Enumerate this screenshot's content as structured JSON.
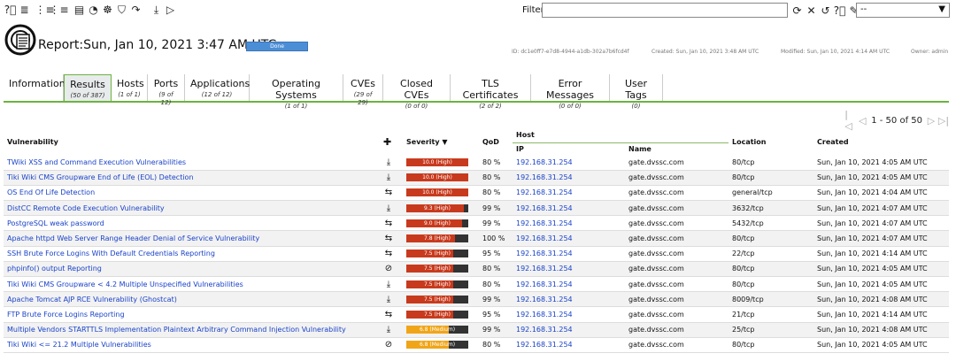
{
  "toolbar": {
    "icons": [
      "help-icon",
      "list-icon",
      "delta-list-icon",
      "delta-list-alt-icon",
      "report-format-icon",
      "task-icon",
      "settings-icon",
      "shield-icon",
      "alert-icon",
      "download-icon",
      "play-icon"
    ],
    "filter_label": "Filter",
    "filter_value": "",
    "filter_icons": [
      "refresh-icon",
      "close-icon",
      "reset-icon",
      "help-icon",
      "edit-icon"
    ],
    "filter_select": "--"
  },
  "header": {
    "title": "Report:Sun, Jan 10, 2021 3:47 AM UTC",
    "status": "Done",
    "id": "ID: dc1e0ff7-e7d8-4944-a1db-302a7b6fcd4f",
    "created": "Created: Sun, Jan 10, 2021 3:48 AM UTC",
    "modified": "Modified: Sun, Jan 10, 2021 4:14 AM UTC",
    "owner": "Owner: admin"
  },
  "tabs": [
    {
      "label": "Information",
      "count": ""
    },
    {
      "label": "Results",
      "count": "(50 of 387)"
    },
    {
      "label": "Hosts",
      "count": "(1 of 1)"
    },
    {
      "label": "Ports",
      "count": "(9 of 12)"
    },
    {
      "label": "Applications",
      "count": "(12 of 12)"
    },
    {
      "label": "Operating Systems",
      "count": "(1 of 1)"
    },
    {
      "label": "CVEs",
      "count": "(29 of 29)"
    },
    {
      "label": "Closed CVEs",
      "count": "(0 of 0)"
    },
    {
      "label": "TLS Certificates",
      "count": "(2 of 2)"
    },
    {
      "label": "Error Messages",
      "count": "(0 of 0)"
    },
    {
      "label": "User Tags",
      "count": "(0)"
    }
  ],
  "pager": {
    "text": "1 - 50 of 50"
  },
  "table": {
    "headers": {
      "vulnerability": "Vulnerability",
      "severity": "Severity ▼",
      "qod": "QoD",
      "host": "Host",
      "ip": "IP",
      "name": "Name",
      "location": "Location",
      "created": "Created"
    },
    "rows": [
      {
        "vuln": "TWiki XSS and Command Execution Vulnerabilities",
        "sol": "vendorfix",
        "sev": 10.0,
        "sev_label": "10.0 (High)",
        "qod": "80 %",
        "ip": "192.168.31.254",
        "name": "gate.dvssc.com",
        "loc": "80/tcp",
        "created": "Sun, Jan 10, 2021 4:05 AM UTC"
      },
      {
        "vuln": "Tiki Wiki CMS Groupware End of Life (EOL) Detection",
        "sol": "vendorfix",
        "sev": 10.0,
        "sev_label": "10.0 (High)",
        "qod": "80 %",
        "ip": "192.168.31.254",
        "name": "gate.dvssc.com",
        "loc": "80/tcp",
        "created": "Sun, Jan 10, 2021 4:05 AM UTC"
      },
      {
        "vuln": "OS End Of Life Detection",
        "sol": "mitigation",
        "sev": 10.0,
        "sev_label": "10.0 (High)",
        "qod": "80 %",
        "ip": "192.168.31.254",
        "name": "gate.dvssc.com",
        "loc": "general/tcp",
        "created": "Sun, Jan 10, 2021 4:04 AM UTC"
      },
      {
        "vuln": "DistCC Remote Code Execution Vulnerability",
        "sol": "vendorfix",
        "sev": 9.3,
        "sev_label": "9.3 (High)",
        "qod": "99 %",
        "ip": "192.168.31.254",
        "name": "gate.dvssc.com",
        "loc": "3632/tcp",
        "created": "Sun, Jan 10, 2021 4:07 AM UTC"
      },
      {
        "vuln": "PostgreSQL weak password",
        "sol": "mitigation",
        "sev": 9.0,
        "sev_label": "9.0 (High)",
        "qod": "99 %",
        "ip": "192.168.31.254",
        "name": "gate.dvssc.com",
        "loc": "5432/tcp",
        "created": "Sun, Jan 10, 2021 4:07 AM UTC"
      },
      {
        "vuln": "Apache httpd Web Server Range Header Denial of Service Vulnerability",
        "sol": "mitigation",
        "sev": 7.8,
        "sev_label": "7.8 (High)",
        "qod": "100 %",
        "ip": "192.168.31.254",
        "name": "gate.dvssc.com",
        "loc": "80/tcp",
        "created": "Sun, Jan 10, 2021 4:07 AM UTC"
      },
      {
        "vuln": "SSH Brute Force Logins With Default Credentials Reporting",
        "sol": "mitigation",
        "sev": 7.5,
        "sev_label": "7.5 (High)",
        "qod": "95 %",
        "ip": "192.168.31.254",
        "name": "gate.dvssc.com",
        "loc": "22/tcp",
        "created": "Sun, Jan 10, 2021 4:14 AM UTC"
      },
      {
        "vuln": "phpinfo() output Reporting",
        "sol": "workaround",
        "sev": 7.5,
        "sev_label": "7.5 (High)",
        "qod": "80 %",
        "ip": "192.168.31.254",
        "name": "gate.dvssc.com",
        "loc": "80/tcp",
        "created": "Sun, Jan 10, 2021 4:05 AM UTC"
      },
      {
        "vuln": "Tiki Wiki CMS Groupware < 4.2 Multiple Unspecified Vulnerabilities",
        "sol": "vendorfix",
        "sev": 7.5,
        "sev_label": "7.5 (High)",
        "qod": "80 %",
        "ip": "192.168.31.254",
        "name": "gate.dvssc.com",
        "loc": "80/tcp",
        "created": "Sun, Jan 10, 2021 4:05 AM UTC"
      },
      {
        "vuln": "Apache Tomcat AJP RCE Vulnerability (Ghostcat)",
        "sol": "vendorfix",
        "sev": 7.5,
        "sev_label": "7.5 (High)",
        "qod": "99 %",
        "ip": "192.168.31.254",
        "name": "gate.dvssc.com",
        "loc": "8009/tcp",
        "created": "Sun, Jan 10, 2021 4:08 AM UTC"
      },
      {
        "vuln": "FTP Brute Force Logins Reporting",
        "sol": "mitigation",
        "sev": 7.5,
        "sev_label": "7.5 (High)",
        "qod": "95 %",
        "ip": "192.168.31.254",
        "name": "gate.dvssc.com",
        "loc": "21/tcp",
        "created": "Sun, Jan 10, 2021 4:14 AM UTC"
      },
      {
        "vuln": "Multiple Vendors STARTTLS Implementation Plaintext Arbitrary Command Injection Vulnerability",
        "sol": "vendorfix",
        "sev": 6.8,
        "sev_label": "6.8 (Medium)",
        "qod": "99 %",
        "ip": "192.168.31.254",
        "name": "gate.dvssc.com",
        "loc": "25/tcp",
        "created": "Sun, Jan 10, 2021 4:08 AM UTC"
      },
      {
        "vuln": "Tiki Wiki <= 21.2 Multiple Vulnerabilities",
        "sol": "nonavailable",
        "sev": 6.8,
        "sev_label": "6.8 (Medium)",
        "qod": "80 %",
        "ip": "192.168.31.254",
        "name": "gate.dvssc.com",
        "loc": "80/tcp",
        "created": "Sun, Jan 10, 2021 4:05 AM UTC"
      }
    ]
  },
  "colors": {
    "high": "#c83a1d",
    "medium": "#f0a519",
    "link": "#1a43c8",
    "accent": "#6cb33f"
  }
}
